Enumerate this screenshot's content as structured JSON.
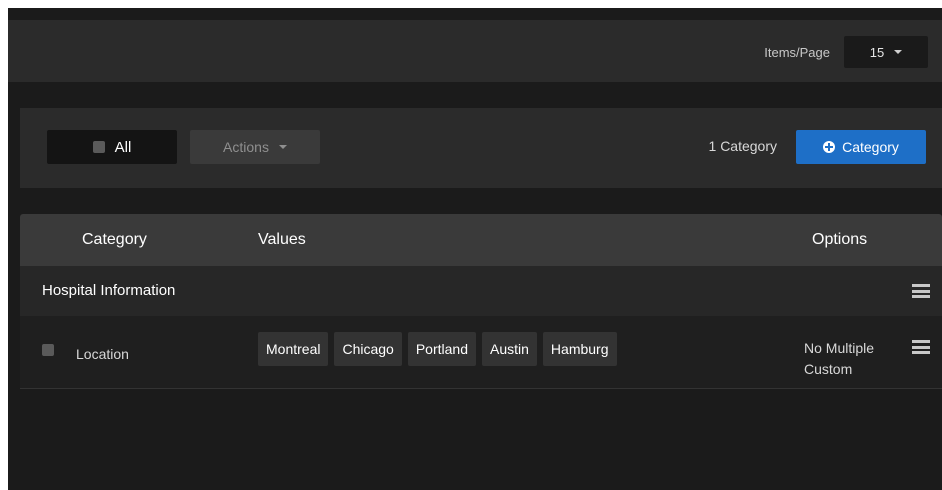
{
  "header": {
    "items_per_page_label": "Items/Page",
    "items_per_page_value": "15"
  },
  "toolbar": {
    "all_label": "All",
    "actions_label": "Actions",
    "category_count": "1 Category",
    "add_category_label": "Category"
  },
  "table": {
    "columns": [
      "Category",
      "Values",
      "Options"
    ],
    "groups": [
      {
        "title": "Hospital Information",
        "rows": [
          {
            "label": "Location",
            "values": [
              "Montreal",
              "Chicago",
              "Portland",
              "Austin",
              "Hamburg"
            ],
            "options": [
              "No Multiple",
              "Custom"
            ]
          }
        ]
      }
    ]
  },
  "colors": {
    "accent": "#1e6fc7",
    "background": "#1b1b1b",
    "panel": "#2b2b2b",
    "header_row": "#3a3a3a"
  },
  "icons": [
    "chevron-down-icon",
    "checkbox-icon",
    "plus-circle-icon",
    "menu-icon"
  ]
}
